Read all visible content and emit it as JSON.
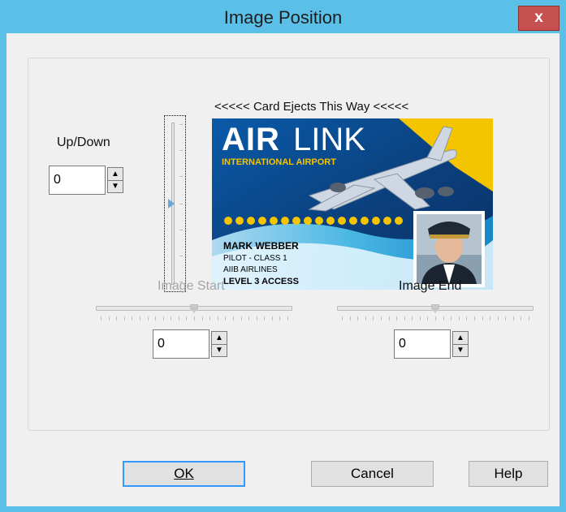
{
  "window": {
    "title": "Image Position",
    "close_label": "x"
  },
  "up_down": {
    "label": "Up/Down",
    "value": "0"
  },
  "card_direction_label": "<<<<< Card Ejects This Way <<<<<",
  "card": {
    "brand_bold": "AIR",
    "brand_light": "LINK",
    "subtitle": "INTERNATIONAL AIRPORT",
    "name": "MARK WEBBER",
    "line1": "PILOT - CLASS 1",
    "line2": "AIIB AIRLINES",
    "access": "LEVEL 3 ACCESS",
    "colors": {
      "accent_yellow": "#f5c400",
      "deep_blue": "#0b3f7c",
      "light_blue": "#4fc4f0"
    }
  },
  "image_start": {
    "label": "Image Start",
    "value": "0",
    "enabled": false,
    "slider_position": 0.5
  },
  "image_end": {
    "label": "Image End",
    "value": "0",
    "enabled": true,
    "slider_position": 0.5
  },
  "buttons": {
    "ok": "OK",
    "cancel": "Cancel",
    "help": "Help"
  },
  "icons": {
    "spin_up": "▲",
    "spin_down": "▼"
  }
}
